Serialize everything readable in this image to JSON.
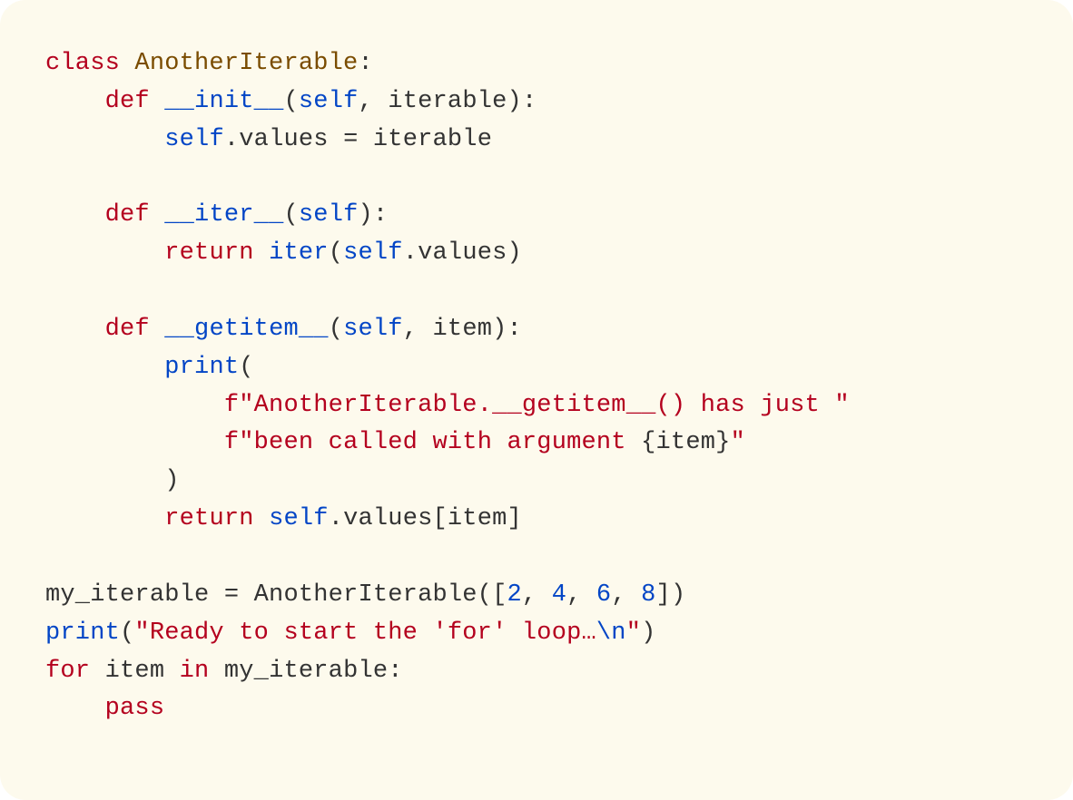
{
  "code": {
    "lines": [
      [
        {
          "t": "class ",
          "c": "tok-kw"
        },
        {
          "t": "AnotherIterable",
          "c": "tok-cls"
        },
        {
          "t": ":",
          "c": ""
        }
      ],
      [
        {
          "t": "    ",
          "c": ""
        },
        {
          "t": "def ",
          "c": "tok-kw"
        },
        {
          "t": "__init__",
          "c": "tok-fn"
        },
        {
          "t": "(",
          "c": ""
        },
        {
          "t": "self",
          "c": "tok-self"
        },
        {
          "t": ", iterable):",
          "c": ""
        }
      ],
      [
        {
          "t": "        ",
          "c": ""
        },
        {
          "t": "self",
          "c": "tok-self"
        },
        {
          "t": ".values = iterable",
          "c": ""
        }
      ],
      [
        {
          "t": "",
          "c": ""
        }
      ],
      [
        {
          "t": "    ",
          "c": ""
        },
        {
          "t": "def ",
          "c": "tok-kw"
        },
        {
          "t": "__iter__",
          "c": "tok-fn"
        },
        {
          "t": "(",
          "c": ""
        },
        {
          "t": "self",
          "c": "tok-self"
        },
        {
          "t": "):",
          "c": ""
        }
      ],
      [
        {
          "t": "        ",
          "c": ""
        },
        {
          "t": "return ",
          "c": "tok-kw"
        },
        {
          "t": "iter",
          "c": "tok-call"
        },
        {
          "t": "(",
          "c": ""
        },
        {
          "t": "self",
          "c": "tok-self"
        },
        {
          "t": ".values)",
          "c": ""
        }
      ],
      [
        {
          "t": "",
          "c": ""
        }
      ],
      [
        {
          "t": "    ",
          "c": ""
        },
        {
          "t": "def ",
          "c": "tok-kw"
        },
        {
          "t": "__getitem__",
          "c": "tok-fn"
        },
        {
          "t": "(",
          "c": ""
        },
        {
          "t": "self",
          "c": "tok-self"
        },
        {
          "t": ", item):",
          "c": ""
        }
      ],
      [
        {
          "t": "        ",
          "c": ""
        },
        {
          "t": "print",
          "c": "tok-call"
        },
        {
          "t": "(",
          "c": ""
        }
      ],
      [
        {
          "t": "            ",
          "c": ""
        },
        {
          "t": "f\"AnotherIterable.__getitem__() has just \"",
          "c": "tok-str"
        }
      ],
      [
        {
          "t": "            ",
          "c": ""
        },
        {
          "t": "f\"been called with argument ",
          "c": "tok-str"
        },
        {
          "t": "{",
          "c": "tok-interp"
        },
        {
          "t": "item",
          "c": "tok-interp"
        },
        {
          "t": "}",
          "c": "tok-interp"
        },
        {
          "t": "\"",
          "c": "tok-str"
        }
      ],
      [
        {
          "t": "        )",
          "c": ""
        }
      ],
      [
        {
          "t": "        ",
          "c": ""
        },
        {
          "t": "return ",
          "c": "tok-kw"
        },
        {
          "t": "self",
          "c": "tok-self"
        },
        {
          "t": ".values[item]",
          "c": ""
        }
      ],
      [
        {
          "t": "",
          "c": ""
        }
      ],
      [
        {
          "t": "my_iterable = AnotherIterable([",
          "c": ""
        },
        {
          "t": "2",
          "c": "tok-num"
        },
        {
          "t": ", ",
          "c": ""
        },
        {
          "t": "4",
          "c": "tok-num"
        },
        {
          "t": ", ",
          "c": ""
        },
        {
          "t": "6",
          "c": "tok-num"
        },
        {
          "t": ", ",
          "c": ""
        },
        {
          "t": "8",
          "c": "tok-num"
        },
        {
          "t": "])",
          "c": ""
        }
      ],
      [
        {
          "t": "print",
          "c": "tok-call"
        },
        {
          "t": "(",
          "c": ""
        },
        {
          "t": "\"Ready to start the 'for' loop…",
          "c": "tok-str"
        },
        {
          "t": "\\n",
          "c": "tok-esc"
        },
        {
          "t": "\"",
          "c": "tok-str"
        },
        {
          "t": ")",
          "c": ""
        }
      ],
      [
        {
          "t": "for ",
          "c": "tok-kw"
        },
        {
          "t": "item ",
          "c": ""
        },
        {
          "t": "in ",
          "c": "tok-kw"
        },
        {
          "t": "my_iterable:",
          "c": ""
        }
      ],
      [
        {
          "t": "    ",
          "c": ""
        },
        {
          "t": "pass",
          "c": "tok-kw"
        }
      ]
    ]
  }
}
